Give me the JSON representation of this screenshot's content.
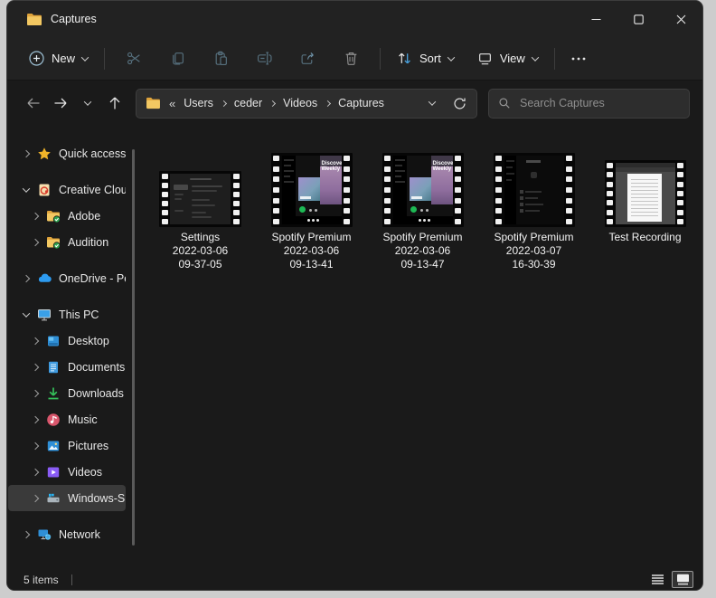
{
  "window": {
    "title": "Captures"
  },
  "toolbar": {
    "new_label": "New",
    "sort_label": "Sort",
    "view_label": "View"
  },
  "addressbar": {
    "overflow": "«",
    "crumbs": [
      "Users",
      "ceder",
      "Videos",
      "Captures"
    ]
  },
  "search": {
    "placeholder": "Search Captures"
  },
  "sidebar": {
    "items": [
      {
        "label": "Quick access"
      },
      {
        "label": "Creative Cloud"
      },
      {
        "label": "Adobe"
      },
      {
        "label": "Audition"
      },
      {
        "label": "OneDrive - Per"
      },
      {
        "label": "This PC"
      },
      {
        "label": "Desktop"
      },
      {
        "label": "Documents"
      },
      {
        "label": "Downloads"
      },
      {
        "label": "Music"
      },
      {
        "label": "Pictures"
      },
      {
        "label": "Videos"
      },
      {
        "label": "Windows-SSD"
      },
      {
        "label": "Network"
      }
    ]
  },
  "files": {
    "items": [
      {
        "name": "Settings",
        "date": "2022-03-06",
        "time": "09-37-05"
      },
      {
        "name": "Spotify Premium",
        "date": "2022-03-06",
        "time": "09-13-41",
        "art_title": "Discover Weekly"
      },
      {
        "name": "Spotify Premium",
        "date": "2022-03-06",
        "time": "09-13-47",
        "art_title": "Discover Weekly"
      },
      {
        "name": "Spotify Premium",
        "date": "2022-03-07",
        "time": "16-30-39"
      },
      {
        "name": "Test Recording"
      }
    ]
  },
  "statusbar": {
    "count": "5 items"
  },
  "colors": {
    "accent_blue": "#4aa3e0",
    "folder_yellow": "#f3c862",
    "spotify_green": "#1db954",
    "selection_gray": "#3a3a3a",
    "disabled_icon_blue": "#56707e"
  }
}
